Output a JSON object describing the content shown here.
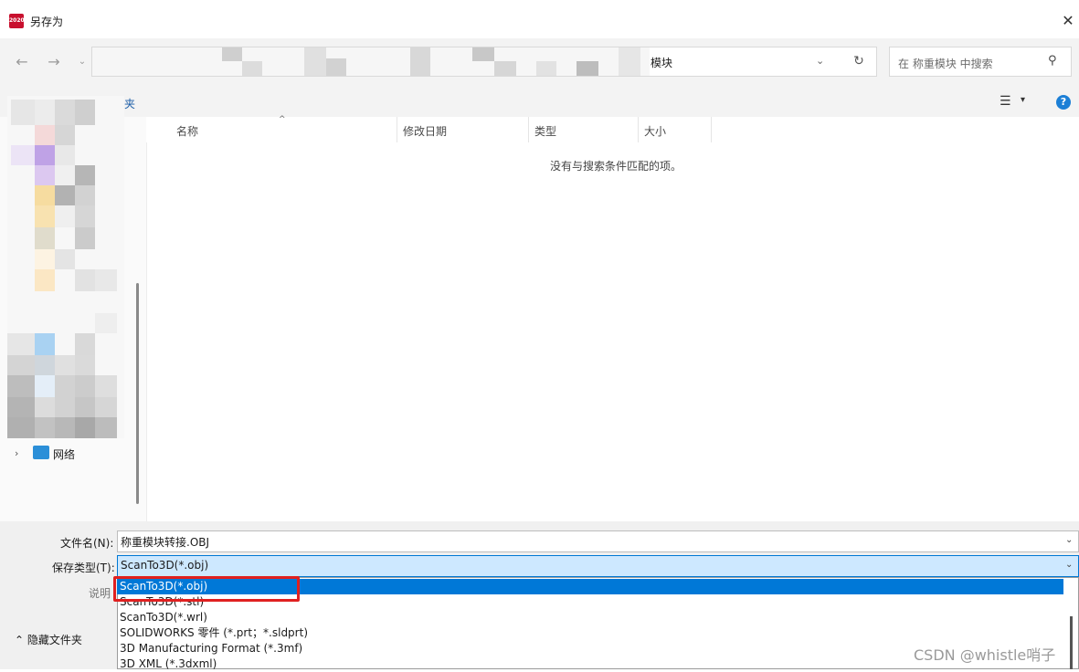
{
  "window": {
    "title": "另存为",
    "app_icon_text": "2020"
  },
  "nav": {
    "address_tail": "模块",
    "search_placeholder": "在 称重模块 中搜索"
  },
  "toolbar": {
    "new_folder": "夹"
  },
  "left_pane": {
    "network_label": "网络"
  },
  "columns": [
    "名称",
    "修改日期",
    "类型",
    "大小"
  ],
  "empty_message": "没有与搜索条件匹配的项。",
  "bottom": {
    "filename_label": "文件名(N):",
    "filename_value": "称重模块转接.OBJ",
    "filetype_label": "保存类型(T):",
    "filetype_value": "ScanTo3D(*.obj)",
    "description_label": "说明",
    "hide_folders": "隐藏文件夹"
  },
  "filetype_options": [
    {
      "label": "ScanTo3D(*.obj)",
      "selected": true
    },
    {
      "label": "ScanTo3D(*.stl)",
      "selected": false
    },
    {
      "label": "ScanTo3D(*.wrl)",
      "selected": false
    },
    {
      "label": "SOLIDWORKS 零件 (*.prt；*.sldprt)",
      "selected": false
    },
    {
      "label": "3D Manufacturing Format (*.3mf)",
      "selected": false
    },
    {
      "label": "3D XML (*.3dxml)",
      "selected": false
    }
  ],
  "watermark": "CSDN @whistle哨子",
  "colors": {
    "accent": "#0078d7",
    "highlight_box": "#e02020"
  }
}
